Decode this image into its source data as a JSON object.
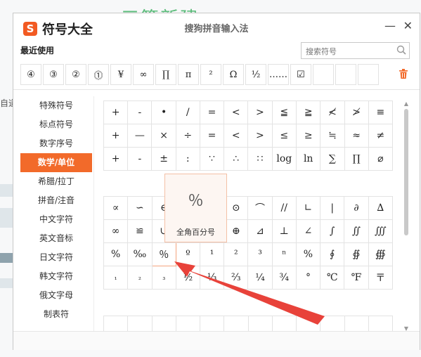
{
  "background": {
    "title_fragment": "三篇新建",
    "left_text": "自道"
  },
  "window": {
    "app_name": "符号大全",
    "logo_letter": "S",
    "center_title": "搜狗拼音输入法",
    "minimize_glyph": "—",
    "close_glyph": "✕"
  },
  "recent": {
    "label": "最近使用",
    "items": [
      "④",
      "③",
      "②",
      "⓵",
      "¥",
      "∞",
      "∏",
      "π",
      "²",
      "Ω",
      "½",
      "……",
      "☑",
      "",
      "",
      ""
    ]
  },
  "search": {
    "placeholder": "搜索符号"
  },
  "sidebar": {
    "items": [
      "特殊符号",
      "标点符号",
      "数字序号",
      "数学/单位",
      "希腊/拉丁",
      "拼音/注音",
      "中文字符",
      "英文音标",
      "日文字符",
      "韩文字符",
      "俄文字母",
      "制表符"
    ],
    "active_index": 3
  },
  "grid_top": [
    [
      "+",
      "-",
      "•",
      "/",
      "=",
      "<",
      ">",
      "≦",
      "≧",
      "≮",
      "≯",
      "≡"
    ],
    [
      "+",
      "—",
      "×",
      "÷",
      "=",
      "<",
      ">",
      "≤",
      "≥",
      "≒",
      "≈",
      "≠"
    ],
    [
      "+",
      "-",
      "±",
      ":",
      "∵",
      "∴",
      "∷",
      "log",
      "ln",
      "∑",
      "∏",
      "⌀"
    ]
  ],
  "grid_bottom": [
    [
      "∝",
      "∽",
      "∈",
      "",
      "",
      "⊙",
      "⌒",
      "//",
      "∟",
      "|",
      "∂",
      "∆"
    ],
    [
      "∞",
      "≌",
      "∪",
      "",
      "",
      "⊕",
      "⊿",
      "⊥",
      "∠",
      "∫",
      "∬",
      "∭"
    ],
    [
      "%",
      "‰",
      "％",
      "º",
      "¹",
      "²",
      "³",
      "ⁿ",
      "%",
      "∮",
      "∯",
      "∰"
    ],
    [
      "₁",
      "₂",
      "₃",
      "½",
      "⅓",
      "⅔",
      "¼",
      "¾",
      "°",
      "℃",
      "℉",
      "〒"
    ]
  ],
  "selected": {
    "row": 2,
    "col": 2
  },
  "tooltip": {
    "symbol": "％",
    "label": "全角百分号"
  },
  "colors": {
    "accent": "#f26a2a",
    "arrow": "#e8423a",
    "selected_border": "#f4a47e"
  }
}
